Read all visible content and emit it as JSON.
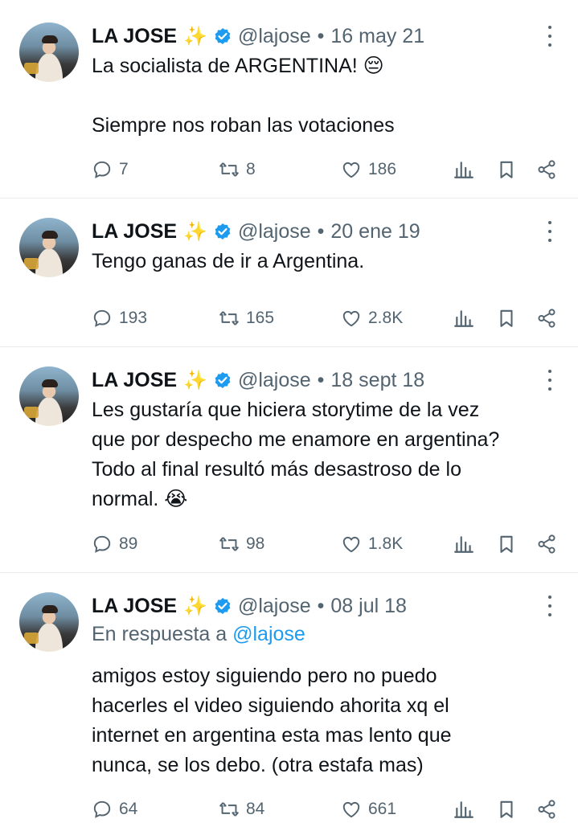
{
  "tweets": [
    {
      "name": "LA JOSE",
      "sparkle": "✨",
      "handle": "@lajose",
      "separator": "•",
      "date": "16 may 21",
      "lines": [
        "La socialista de ARGENTINA! 😔",
        "",
        "Siempre nos roban las votaciones"
      ],
      "replies": "7",
      "retweets": "8",
      "likes": "186"
    },
    {
      "name": "LA JOSE",
      "sparkle": "✨",
      "handle": "@lajose",
      "separator": "•",
      "date": "20 ene 19",
      "lines": [
        "Tengo ganas de ir a Argentina."
      ],
      "replies": "193",
      "retweets": "165",
      "likes": "2.8K"
    },
    {
      "name": "LA JOSE",
      "sparkle": "✨",
      "handle": "@lajose",
      "separator": "•",
      "date": "18 sept 18",
      "lines": [
        "Les gustaría que hiciera storytime de la vez",
        "que por despecho me enamore en argentina?",
        "Todo al final resultó más desastroso de lo",
        "normal. 😭"
      ],
      "replies": "89",
      "retweets": "98",
      "likes": "1.8K"
    },
    {
      "name": "LA JOSE",
      "sparkle": "✨",
      "handle": "@lajose",
      "separator": "•",
      "date": "08 jul 18",
      "reply_prefix": "En respuesta a",
      "reply_handle": "@lajose",
      "lines": [
        "amigos estoy siguiendo pero no puedo",
        "hacerles el video siguiendo ahorita xq el",
        "internet en argentina esta mas lento que",
        "nunca, se los debo. (otra estafa mas)"
      ],
      "replies": "64",
      "retweets": "84",
      "likes": "661"
    }
  ],
  "colors": {
    "text": "#0f1419",
    "secondary": "#536471",
    "verified": "#1d9bf0",
    "link": "#1d9bf0",
    "divider": "#e8ecee"
  },
  "icons": [
    "more-icon",
    "verified-badge-icon",
    "reply-icon",
    "retweet-icon",
    "like-icon",
    "views-icon",
    "bookmark-icon",
    "share-icon"
  ]
}
